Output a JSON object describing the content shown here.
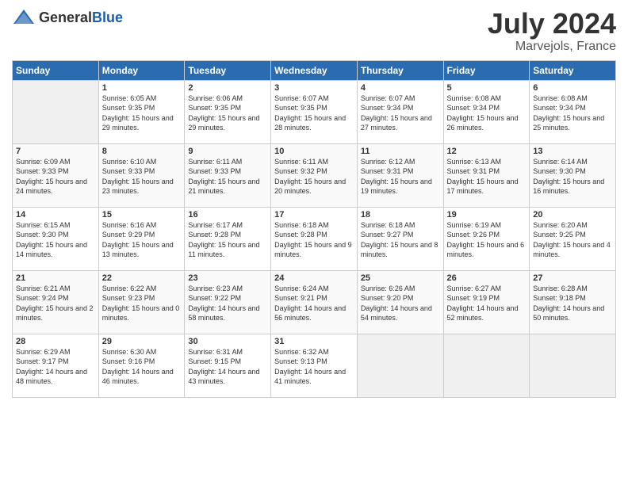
{
  "logo": {
    "text_general": "General",
    "text_blue": "Blue"
  },
  "title": {
    "month_year": "July 2024",
    "location": "Marvejols, France"
  },
  "calendar": {
    "headers": [
      "Sunday",
      "Monday",
      "Tuesday",
      "Wednesday",
      "Thursday",
      "Friday",
      "Saturday"
    ],
    "weeks": [
      [
        {
          "day": "",
          "sunrise": "",
          "sunset": "",
          "daylight": ""
        },
        {
          "day": "1",
          "sunrise": "Sunrise: 6:05 AM",
          "sunset": "Sunset: 9:35 PM",
          "daylight": "Daylight: 15 hours and 29 minutes."
        },
        {
          "day": "2",
          "sunrise": "Sunrise: 6:06 AM",
          "sunset": "Sunset: 9:35 PM",
          "daylight": "Daylight: 15 hours and 29 minutes."
        },
        {
          "day": "3",
          "sunrise": "Sunrise: 6:07 AM",
          "sunset": "Sunset: 9:35 PM",
          "daylight": "Daylight: 15 hours and 28 minutes."
        },
        {
          "day": "4",
          "sunrise": "Sunrise: 6:07 AM",
          "sunset": "Sunset: 9:34 PM",
          "daylight": "Daylight: 15 hours and 27 minutes."
        },
        {
          "day": "5",
          "sunrise": "Sunrise: 6:08 AM",
          "sunset": "Sunset: 9:34 PM",
          "daylight": "Daylight: 15 hours and 26 minutes."
        },
        {
          "day": "6",
          "sunrise": "Sunrise: 6:08 AM",
          "sunset": "Sunset: 9:34 PM",
          "daylight": "Daylight: 15 hours and 25 minutes."
        }
      ],
      [
        {
          "day": "7",
          "sunrise": "Sunrise: 6:09 AM",
          "sunset": "Sunset: 9:33 PM",
          "daylight": "Daylight: 15 hours and 24 minutes."
        },
        {
          "day": "8",
          "sunrise": "Sunrise: 6:10 AM",
          "sunset": "Sunset: 9:33 PM",
          "daylight": "Daylight: 15 hours and 23 minutes."
        },
        {
          "day": "9",
          "sunrise": "Sunrise: 6:11 AM",
          "sunset": "Sunset: 9:33 PM",
          "daylight": "Daylight: 15 hours and 21 minutes."
        },
        {
          "day": "10",
          "sunrise": "Sunrise: 6:11 AM",
          "sunset": "Sunset: 9:32 PM",
          "daylight": "Daylight: 15 hours and 20 minutes."
        },
        {
          "day": "11",
          "sunrise": "Sunrise: 6:12 AM",
          "sunset": "Sunset: 9:31 PM",
          "daylight": "Daylight: 15 hours and 19 minutes."
        },
        {
          "day": "12",
          "sunrise": "Sunrise: 6:13 AM",
          "sunset": "Sunset: 9:31 PM",
          "daylight": "Daylight: 15 hours and 17 minutes."
        },
        {
          "day": "13",
          "sunrise": "Sunrise: 6:14 AM",
          "sunset": "Sunset: 9:30 PM",
          "daylight": "Daylight: 15 hours and 16 minutes."
        }
      ],
      [
        {
          "day": "14",
          "sunrise": "Sunrise: 6:15 AM",
          "sunset": "Sunset: 9:30 PM",
          "daylight": "Daylight: 15 hours and 14 minutes."
        },
        {
          "day": "15",
          "sunrise": "Sunrise: 6:16 AM",
          "sunset": "Sunset: 9:29 PM",
          "daylight": "Daylight: 15 hours and 13 minutes."
        },
        {
          "day": "16",
          "sunrise": "Sunrise: 6:17 AM",
          "sunset": "Sunset: 9:28 PM",
          "daylight": "Daylight: 15 hours and 11 minutes."
        },
        {
          "day": "17",
          "sunrise": "Sunrise: 6:18 AM",
          "sunset": "Sunset: 9:28 PM",
          "daylight": "Daylight: 15 hours and 9 minutes."
        },
        {
          "day": "18",
          "sunrise": "Sunrise: 6:18 AM",
          "sunset": "Sunset: 9:27 PM",
          "daylight": "Daylight: 15 hours and 8 minutes."
        },
        {
          "day": "19",
          "sunrise": "Sunrise: 6:19 AM",
          "sunset": "Sunset: 9:26 PM",
          "daylight": "Daylight: 15 hours and 6 minutes."
        },
        {
          "day": "20",
          "sunrise": "Sunrise: 6:20 AM",
          "sunset": "Sunset: 9:25 PM",
          "daylight": "Daylight: 15 hours and 4 minutes."
        }
      ],
      [
        {
          "day": "21",
          "sunrise": "Sunrise: 6:21 AM",
          "sunset": "Sunset: 9:24 PM",
          "daylight": "Daylight: 15 hours and 2 minutes."
        },
        {
          "day": "22",
          "sunrise": "Sunrise: 6:22 AM",
          "sunset": "Sunset: 9:23 PM",
          "daylight": "Daylight: 15 hours and 0 minutes."
        },
        {
          "day": "23",
          "sunrise": "Sunrise: 6:23 AM",
          "sunset": "Sunset: 9:22 PM",
          "daylight": "Daylight: 14 hours and 58 minutes."
        },
        {
          "day": "24",
          "sunrise": "Sunrise: 6:24 AM",
          "sunset": "Sunset: 9:21 PM",
          "daylight": "Daylight: 14 hours and 56 minutes."
        },
        {
          "day": "25",
          "sunrise": "Sunrise: 6:26 AM",
          "sunset": "Sunset: 9:20 PM",
          "daylight": "Daylight: 14 hours and 54 minutes."
        },
        {
          "day": "26",
          "sunrise": "Sunrise: 6:27 AM",
          "sunset": "Sunset: 9:19 PM",
          "daylight": "Daylight: 14 hours and 52 minutes."
        },
        {
          "day": "27",
          "sunrise": "Sunrise: 6:28 AM",
          "sunset": "Sunset: 9:18 PM",
          "daylight": "Daylight: 14 hours and 50 minutes."
        }
      ],
      [
        {
          "day": "28",
          "sunrise": "Sunrise: 6:29 AM",
          "sunset": "Sunset: 9:17 PM",
          "daylight": "Daylight: 14 hours and 48 minutes."
        },
        {
          "day": "29",
          "sunrise": "Sunrise: 6:30 AM",
          "sunset": "Sunset: 9:16 PM",
          "daylight": "Daylight: 14 hours and 46 minutes."
        },
        {
          "day": "30",
          "sunrise": "Sunrise: 6:31 AM",
          "sunset": "Sunset: 9:15 PM",
          "daylight": "Daylight: 14 hours and 43 minutes."
        },
        {
          "day": "31",
          "sunrise": "Sunrise: 6:32 AM",
          "sunset": "Sunset: 9:13 PM",
          "daylight": "Daylight: 14 hours and 41 minutes."
        },
        {
          "day": "",
          "sunrise": "",
          "sunset": "",
          "daylight": ""
        },
        {
          "day": "",
          "sunrise": "",
          "sunset": "",
          "daylight": ""
        },
        {
          "day": "",
          "sunrise": "",
          "sunset": "",
          "daylight": ""
        }
      ]
    ]
  }
}
